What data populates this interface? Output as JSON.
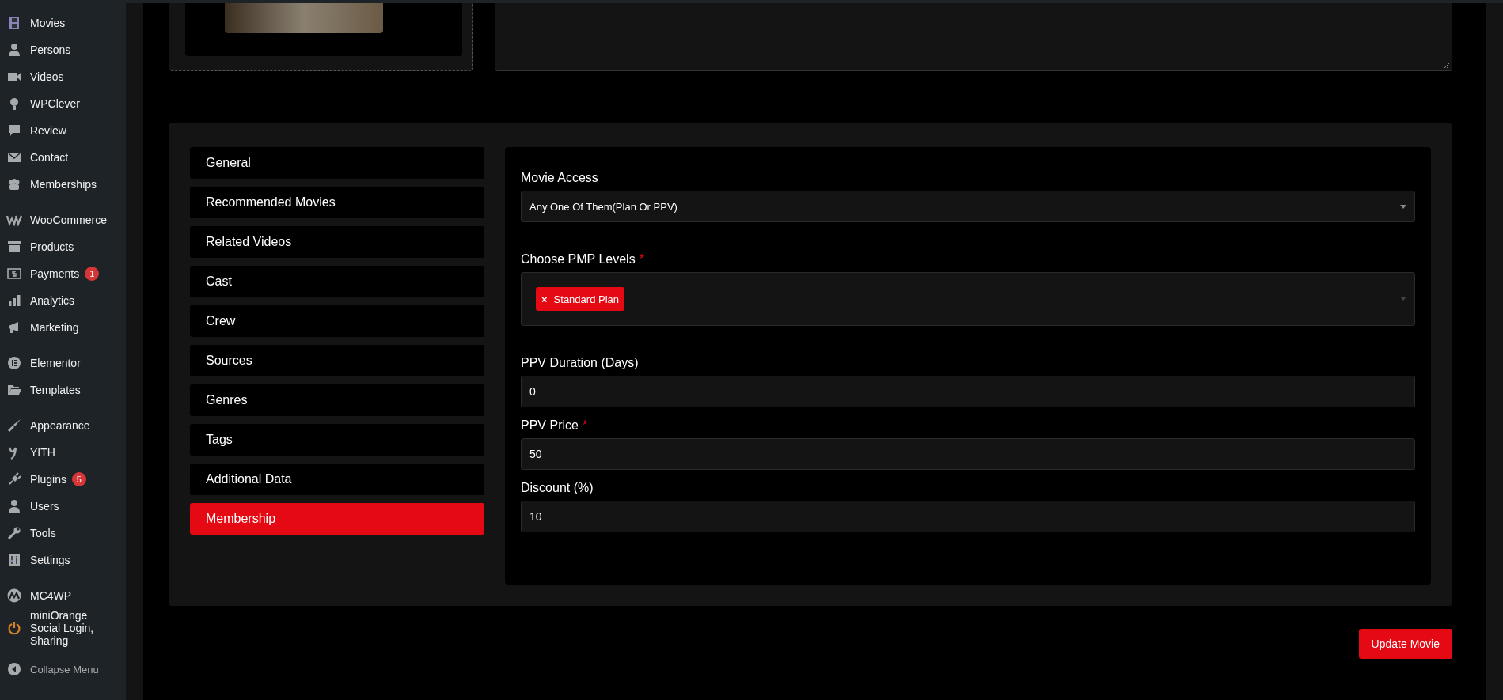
{
  "sidebar": {
    "groups": [
      [
        {
          "label": "Movies"
        },
        {
          "label": "Persons"
        },
        {
          "label": "Videos"
        },
        {
          "label": "WPClever"
        },
        {
          "label": "Review"
        },
        {
          "label": "Contact"
        },
        {
          "label": "Memberships"
        }
      ],
      [
        {
          "label": "WooCommerce"
        },
        {
          "label": "Products"
        },
        {
          "label": "Payments",
          "badge": "1"
        },
        {
          "label": "Analytics"
        },
        {
          "label": "Marketing"
        }
      ],
      [
        {
          "label": "Elementor"
        },
        {
          "label": "Templates"
        }
      ],
      [
        {
          "label": "Appearance"
        },
        {
          "label": "YITH"
        },
        {
          "label": "Plugins",
          "badge": "5"
        },
        {
          "label": "Users"
        },
        {
          "label": "Tools"
        },
        {
          "label": "Settings"
        }
      ],
      [
        {
          "label": "MC4WP"
        },
        {
          "label": "miniOrange Social Login, Sharing"
        }
      ]
    ],
    "collapse": "Collapse Menu"
  },
  "tabs": [
    {
      "label": "General",
      "selected": false
    },
    {
      "label": "Recommended Movies",
      "selected": false
    },
    {
      "label": "Related Videos",
      "selected": false
    },
    {
      "label": "Cast",
      "selected": false
    },
    {
      "label": "Crew",
      "selected": false
    },
    {
      "label": "Sources",
      "selected": false
    },
    {
      "label": "Genres",
      "selected": false
    },
    {
      "label": "Tags",
      "selected": false
    },
    {
      "label": "Additional Data",
      "selected": false
    },
    {
      "label": "Membership",
      "selected": true
    }
  ],
  "fields": [
    {
      "kind": "select",
      "label": "Movie Access",
      "value": "Any One Of Them(Plan Or PPV)"
    },
    {
      "kind": "multiselect",
      "label": "Choose PMP Levels",
      "required_mark": "*",
      "tags": [
        {
          "remove": "×",
          "label": "Standard Plan"
        }
      ]
    },
    {
      "kind": "input",
      "label": "PPV Duration (Days)",
      "value": "0"
    },
    {
      "kind": "input",
      "label": "PPV Price",
      "required_mark": "*",
      "value": "50"
    },
    {
      "kind": "input",
      "label": "Discount (%)",
      "value": "10"
    }
  ],
  "submit": "Update Movie"
}
